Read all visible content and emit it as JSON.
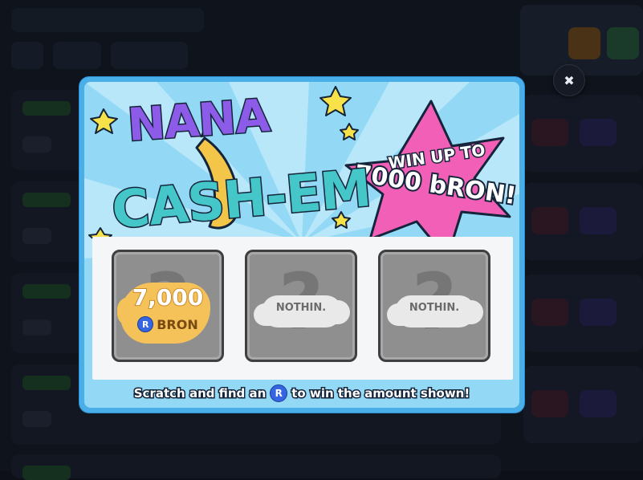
{
  "close_button": {
    "glyph": "✖"
  },
  "modal": {
    "logo_line1": "NANA",
    "logo_line2": "CASH-EM",
    "promo_line1": "WIN UP TO",
    "promo_line2": "7000 bRON!",
    "tiles": [
      {
        "state": "revealed",
        "prize_amount": "7,000",
        "prize_currency": "BRON",
        "coin_letter": "R"
      },
      {
        "state": "empty",
        "label": "NOTHIN."
      },
      {
        "state": "empty",
        "label": "NOTHIN."
      }
    ],
    "instruction_before": "Scratch and find an",
    "instruction_coin": "R",
    "instruction_after": "to win the amount shown!"
  },
  "colors": {
    "modal_border": "#4aaee8",
    "modal_bg": "#93d9f6",
    "star_pink": "#f25fb6",
    "logo_purple": "#8c5be8",
    "logo_teal": "#45c7c9",
    "tile_grey": "#8f8f8f",
    "prize_gold": "#f5c25a",
    "coin_blue": "#3565e0"
  }
}
